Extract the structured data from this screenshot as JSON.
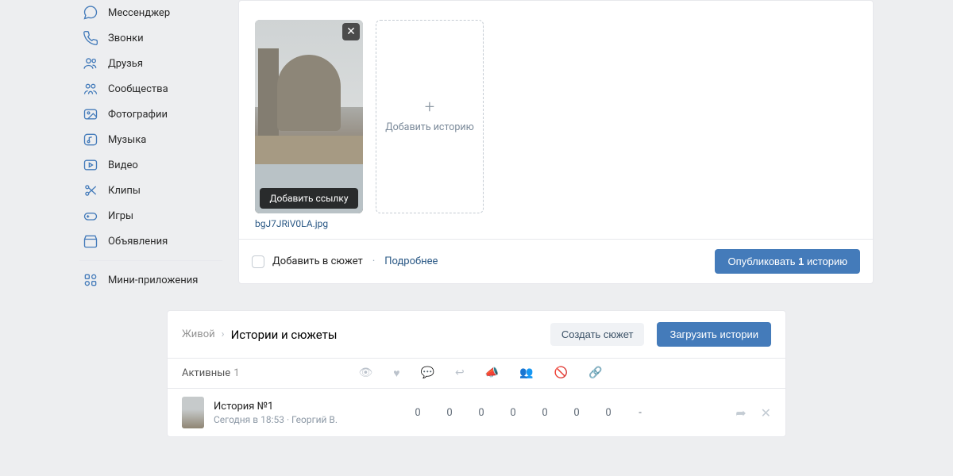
{
  "sidebar": {
    "items": [
      {
        "label": "Мессенджер",
        "icon": "messenger-icon"
      },
      {
        "label": "Звонки",
        "icon": "calls-icon"
      },
      {
        "label": "Друзья",
        "icon": "friends-icon"
      },
      {
        "label": "Сообщества",
        "icon": "communities-icon"
      },
      {
        "label": "Фотографии",
        "icon": "photos-icon"
      },
      {
        "label": "Музыка",
        "icon": "music-icon"
      },
      {
        "label": "Видео",
        "icon": "video-icon"
      },
      {
        "label": "Клипы",
        "icon": "clips-icon"
      },
      {
        "label": "Игры",
        "icon": "games-icon"
      },
      {
        "label": "Объявления",
        "icon": "market-icon"
      }
    ],
    "miniapps_label": "Мини-приложения"
  },
  "composer": {
    "story": {
      "filename": "bgJ7JRiV0LA.jpg",
      "add_link_label": "Добавить ссылку"
    },
    "add_story_label": "Добавить историю",
    "footer": {
      "checkbox_label": "Добавить в сюжет",
      "more_label": "Подробнее",
      "publish_prefix": "Опубликовать ",
      "publish_count": "1",
      "publish_suffix": " историю"
    }
  },
  "stories_panel": {
    "breadcrumb_root": "Живой",
    "breadcrumb_current": "Истории и сюжеты",
    "create_plot_button": "Создать сюжет",
    "upload_button": "Загрузить истории",
    "active_label": "Активные",
    "active_count": "1",
    "row": {
      "title": "История №1",
      "meta": "Сегодня в 18:53 · Георгий В.",
      "stats": [
        "0",
        "0",
        "0",
        "0",
        "0",
        "0",
        "0",
        "-"
      ]
    }
  }
}
